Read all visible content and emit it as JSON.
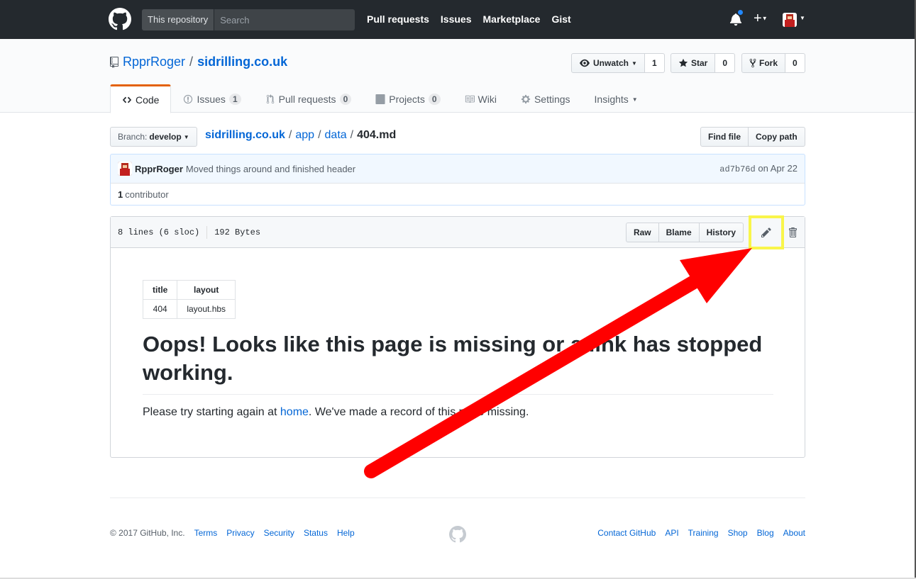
{
  "header": {
    "search_scope": "This repository",
    "search_placeholder": "Search",
    "nav": [
      "Pull requests",
      "Issues",
      "Marketplace",
      "Gist"
    ]
  },
  "repo": {
    "owner": "RpprRoger",
    "separator": "/",
    "name": "sidrilling.co.uk",
    "unwatch_label": "Unwatch",
    "watch_count": "1",
    "star_label": "Star",
    "star_count": "0",
    "fork_label": "Fork",
    "fork_count": "0"
  },
  "reponav": {
    "code": "Code",
    "issues": "Issues",
    "issues_count": "1",
    "pulls": "Pull requests",
    "pulls_count": "0",
    "projects": "Projects",
    "projects_count": "0",
    "wiki": "Wiki",
    "settings": "Settings",
    "insights": "Insights"
  },
  "filenav": {
    "branch_label": "Branch:",
    "branch": "develop",
    "crumbs": [
      "sidrilling.co.uk",
      "app",
      "data"
    ],
    "sep": "/",
    "final": "404.md",
    "find_file": "Find file",
    "copy_path": "Copy path"
  },
  "commit": {
    "author": "RpprRoger",
    "message": "Moved things around and finished header",
    "sha": "ad7b76d",
    "date": "on Apr 22",
    "contributors_count": "1",
    "contributors_label": "contributor"
  },
  "file": {
    "lines": "8 lines (6 sloc)",
    "size": "192 Bytes",
    "raw": "Raw",
    "blame": "Blame",
    "history": "History"
  },
  "markdown": {
    "table_headers": [
      "title",
      "layout"
    ],
    "table_row": [
      "404",
      "layout.hbs"
    ],
    "heading": "Oops! Looks like this page is missing or a link has stopped working.",
    "para_before": "Please try starting again at ",
    "para_link": "home",
    "para_after": ". We've made a record of this page missing."
  },
  "footer": {
    "copyright": "© 2017 GitHub, Inc.",
    "left_links": [
      "Terms",
      "Privacy",
      "Security",
      "Status",
      "Help"
    ],
    "right_links": [
      "Contact GitHub",
      "API",
      "Training",
      "Shop",
      "Blog",
      "About"
    ]
  },
  "colors": {
    "arrow": "#ff0000",
    "highlight": "#f9f54a"
  }
}
